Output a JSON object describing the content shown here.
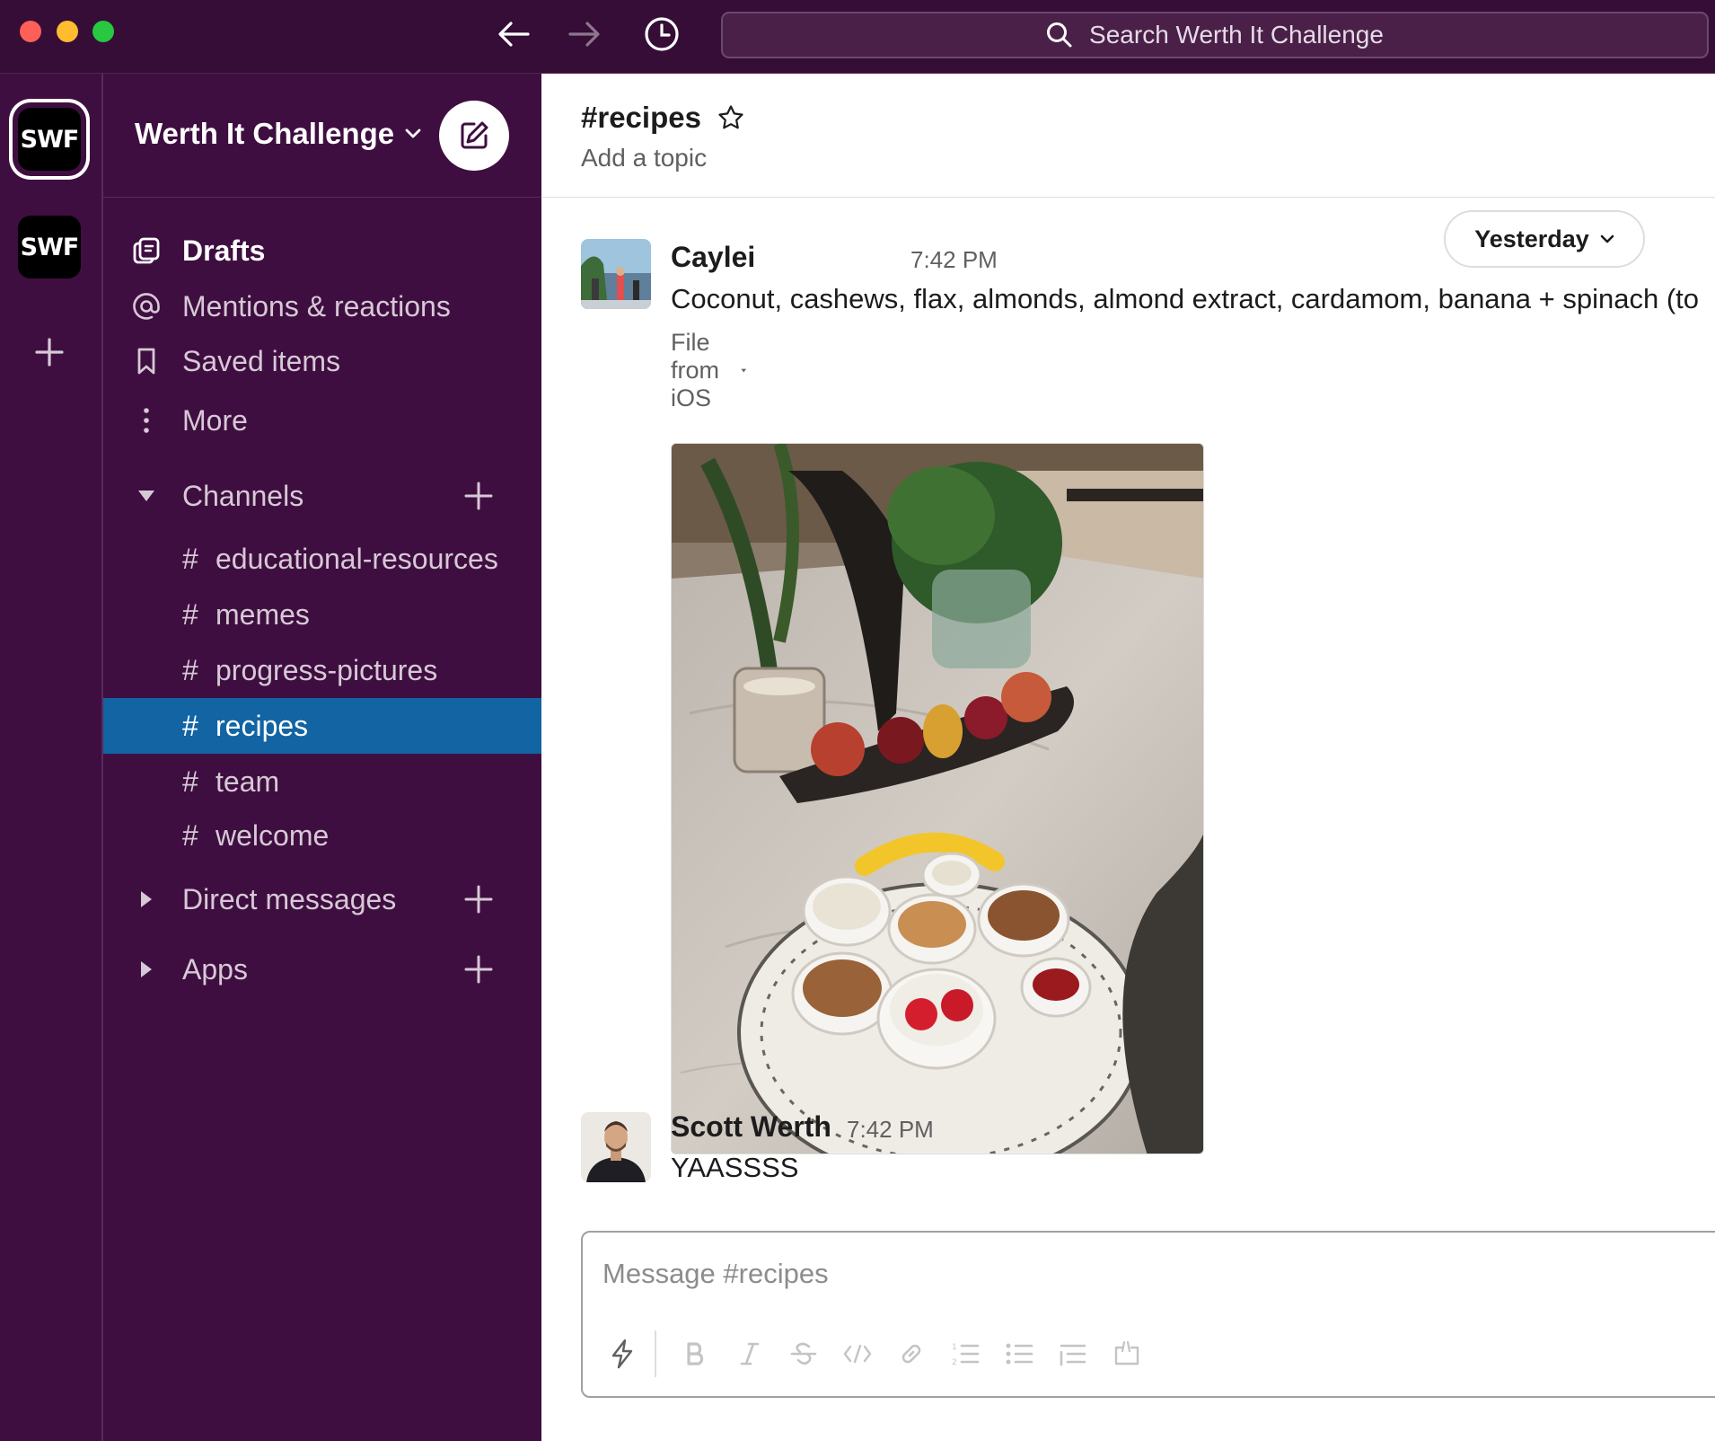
{
  "search": {
    "placeholder": "Search Werth It Challenge"
  },
  "workspaces": [
    {
      "name": "SWF",
      "icon": "swf-logo"
    },
    {
      "name": "SWF",
      "icon": "swf-logo"
    }
  ],
  "sidebar": {
    "workspace_name": "Werth It Challenge",
    "nav": [
      {
        "label": "Drafts",
        "icon": "drafts-icon"
      },
      {
        "label": "Mentions & reactions",
        "icon": "at-icon"
      },
      {
        "label": "Saved items",
        "icon": "bookmark-icon"
      },
      {
        "label": "More",
        "icon": "more-vertical-icon"
      }
    ],
    "channels_header": "Channels",
    "channels": [
      {
        "hash": "#",
        "name": "educational-resources"
      },
      {
        "hash": "#",
        "name": "memes"
      },
      {
        "hash": "#",
        "name": "progress-pictures"
      },
      {
        "hash": "#",
        "name": "recipes"
      },
      {
        "hash": "#",
        "name": "team"
      },
      {
        "hash": "#",
        "name": "welcome"
      }
    ],
    "active_channel": "recipes",
    "dm_header": "Direct messages",
    "apps_header": "Apps"
  },
  "channel": {
    "title": "#recipes",
    "topic": "Add a topic"
  },
  "date_divider": "Yesterday",
  "messages": [
    {
      "sender": "Caylei",
      "time": "7:42 PM",
      "text": "Coconut, cashews, flax, almonds, almond extract, cardamom, banana + spinach (to",
      "file_label": "File from iOS"
    },
    {
      "sender": "Scott Werth",
      "time": "7:42 PM",
      "text": "YAASSSS"
    }
  ],
  "composer": {
    "placeholder": "Message #recipes"
  },
  "colors": {
    "sidebar_bg": "#3f0e40",
    "titlebar_bg": "#350d36",
    "active_channel": "#1264a3"
  }
}
